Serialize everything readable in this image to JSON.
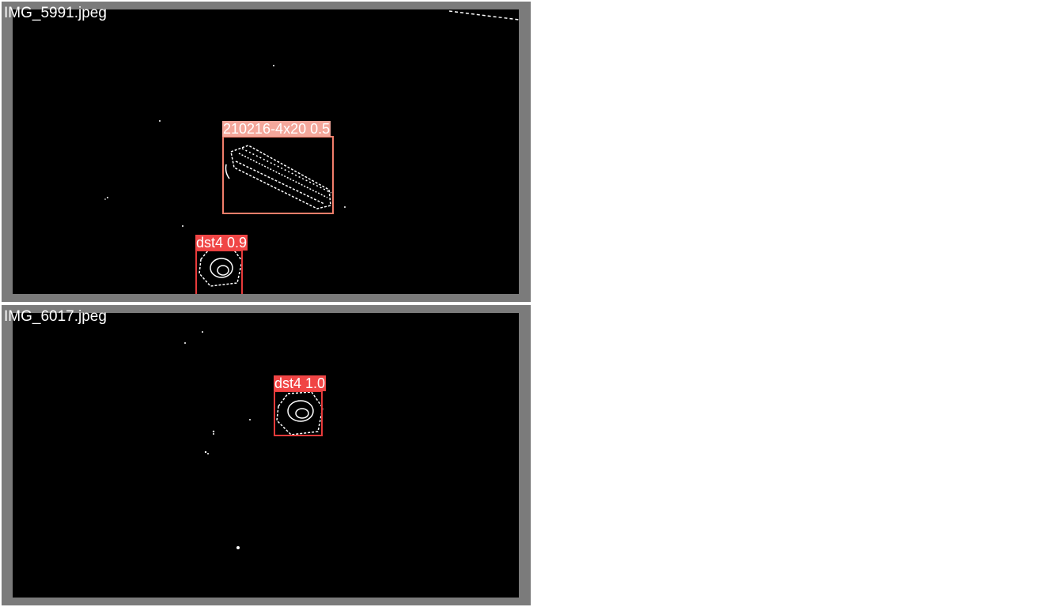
{
  "images": [
    {
      "filename": "IMG_5991.jpeg",
      "detections": [
        {
          "label": "210216-4x20 0.5",
          "box_color": "#f27e6b",
          "label_bg": "#f4a79b"
        },
        {
          "label": "dst4 0.9",
          "box_color": "#e83b3b",
          "label_bg": "#f04545"
        }
      ]
    },
    {
      "filename": "IMG_6017.jpeg",
      "detections": [
        {
          "label": "dst4 1.0",
          "box_color": "#e83b3b",
          "label_bg": "#f04545"
        }
      ]
    }
  ]
}
